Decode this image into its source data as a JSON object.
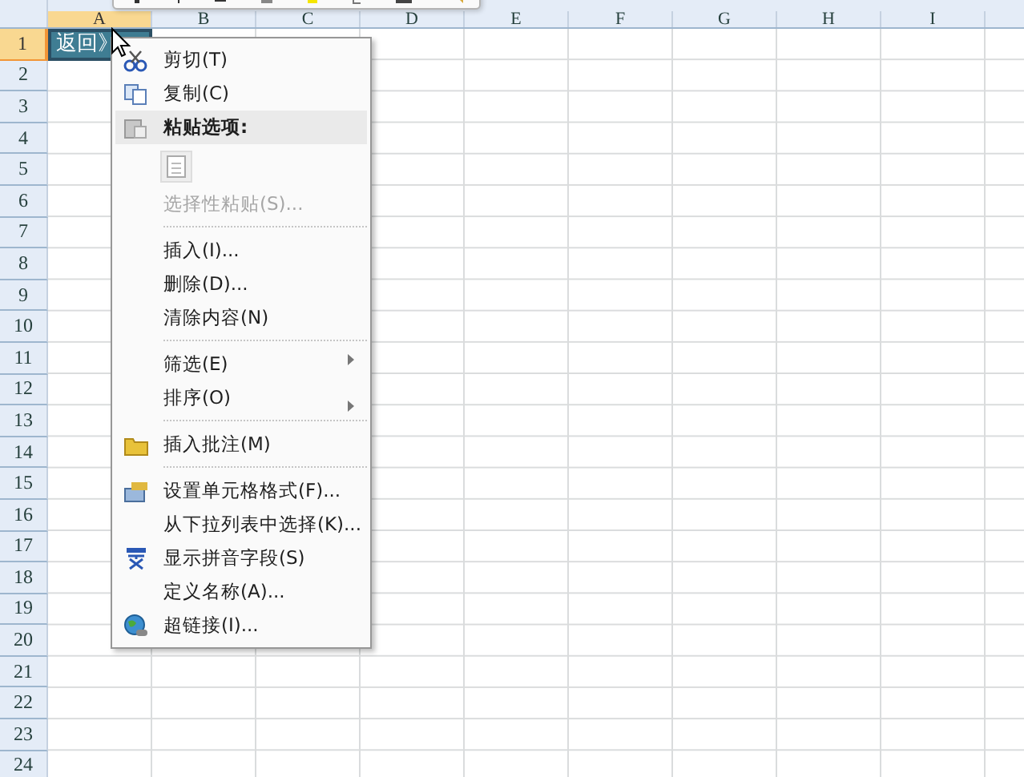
{
  "sheet": {
    "columns": [
      {
        "label": "A",
        "selected": true
      },
      {
        "label": "B",
        "selected": false
      },
      {
        "label": "C",
        "selected": false
      },
      {
        "label": "D",
        "selected": false
      },
      {
        "label": "E",
        "selected": false
      },
      {
        "label": "F",
        "selected": false
      },
      {
        "label": "G",
        "selected": false
      },
      {
        "label": "H",
        "selected": false
      },
      {
        "label": "I",
        "selected": false
      }
    ],
    "rows": [
      {
        "label": "1",
        "selected": true
      },
      {
        "label": "2",
        "selected": false
      },
      {
        "label": "3",
        "selected": false
      },
      {
        "label": "4",
        "selected": false
      },
      {
        "label": "5",
        "selected": false
      },
      {
        "label": "6",
        "selected": false
      },
      {
        "label": "7",
        "selected": false
      },
      {
        "label": "8",
        "selected": false
      },
      {
        "label": "9",
        "selected": false
      },
      {
        "label": "10",
        "selected": false
      },
      {
        "label": "11",
        "selected": false
      },
      {
        "label": "12",
        "selected": false
      },
      {
        "label": "13",
        "selected": false
      },
      {
        "label": "14",
        "selected": false
      },
      {
        "label": "15",
        "selected": false
      },
      {
        "label": "16",
        "selected": false
      },
      {
        "label": "17",
        "selected": false
      },
      {
        "label": "18",
        "selected": false
      },
      {
        "label": "19",
        "selected": false
      },
      {
        "label": "20",
        "selected": false
      },
      {
        "label": "21",
        "selected": false
      },
      {
        "label": "22",
        "selected": false
      },
      {
        "label": "23",
        "selected": false
      },
      {
        "label": "24",
        "selected": false
      }
    ],
    "active_cell": {
      "text": "返回》",
      "selected": true
    }
  },
  "context_menu": {
    "items": [
      {
        "kind": "item",
        "label": "剪切(T)",
        "disabled": false,
        "submenu": false,
        "separator_before": false
      },
      {
        "kind": "item",
        "label": "复制(C)",
        "disabled": false,
        "submenu": false,
        "separator_before": false
      },
      {
        "kind": "header",
        "label": "粘贴选项:"
      },
      {
        "kind": "paste_buttons"
      },
      {
        "kind": "item",
        "label": "选择性粘贴(S)...",
        "disabled": true,
        "submenu": false,
        "separator_before": false
      },
      {
        "kind": "item",
        "label": "插入(I)...",
        "disabled": false,
        "submenu": false,
        "separator_before": true
      },
      {
        "kind": "item",
        "label": "删除(D)...",
        "disabled": false,
        "submenu": false,
        "separator_before": false
      },
      {
        "kind": "item",
        "label": "清除内容(N)",
        "disabled": false,
        "submenu": false,
        "separator_before": false
      },
      {
        "kind": "item",
        "label": "筛选(E)",
        "disabled": false,
        "submenu": true,
        "separator_before": true
      },
      {
        "kind": "item",
        "label": "排序(O)",
        "disabled": false,
        "submenu": true,
        "separator_before": false
      },
      {
        "kind": "item",
        "label": "插入批注(M)",
        "disabled": false,
        "submenu": false,
        "separator_before": true
      },
      {
        "kind": "item",
        "label": "设置单元格格式(F)...",
        "disabled": false,
        "submenu": false,
        "separator_before": true
      },
      {
        "kind": "item",
        "label": "从下拉列表中选择(K)...",
        "disabled": false,
        "submenu": false,
        "separator_before": false
      },
      {
        "kind": "item",
        "label": "显示拼音字段(S)",
        "disabled": false,
        "submenu": false,
        "separator_before": false
      },
      {
        "kind": "item",
        "label": "定义名称(A)...",
        "disabled": false,
        "submenu": false,
        "separator_before": false
      },
      {
        "kind": "item",
        "label": "超链接(I)...",
        "disabled": false,
        "submenu": false,
        "separator_before": false
      }
    ]
  }
}
